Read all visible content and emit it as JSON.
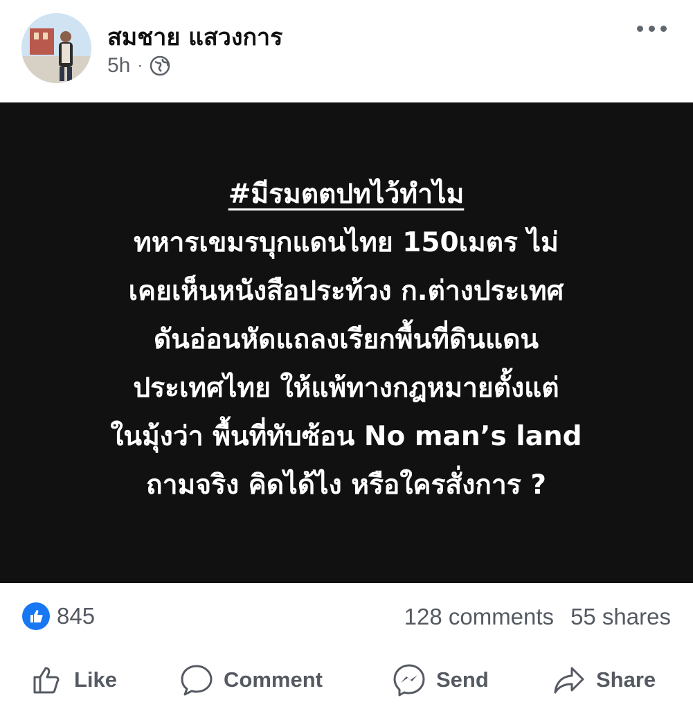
{
  "post": {
    "author": "สมชาย แสวงการ",
    "time": "5h",
    "separator": "·",
    "privacy_icon": "globe-icon",
    "more_icon": "more-options-icon",
    "content": {
      "hashtag": "#มีรมตตปทไว้ทำไม",
      "lines": [
        "ทหารเขมรบุกแดนไทย 150เมตร ไม่",
        "เคยเห็นหนังสือประท้วง ก.ต่างประเทศ",
        "ดันอ่อนหัดแถลงเรียกพื้นที่ดินแดน",
        "ประเทศไทย ให้แพ้ทางกฎหมายตั้งแต่",
        "ในมุ้งว่า พื้นที่ทับซ้อน No man’s land",
        "ถามจริง คิดได้ไง หรือใครสั่งการ ?"
      ]
    }
  },
  "stats": {
    "likes": "845",
    "comments": "128 comments",
    "shares": "55 shares"
  },
  "actions": {
    "like": "Like",
    "comment": "Comment",
    "send": "Send",
    "share": "Share"
  },
  "colors": {
    "post_background": "#111112",
    "like_blue": "#1877f2",
    "secondary_text": "#555a62"
  }
}
